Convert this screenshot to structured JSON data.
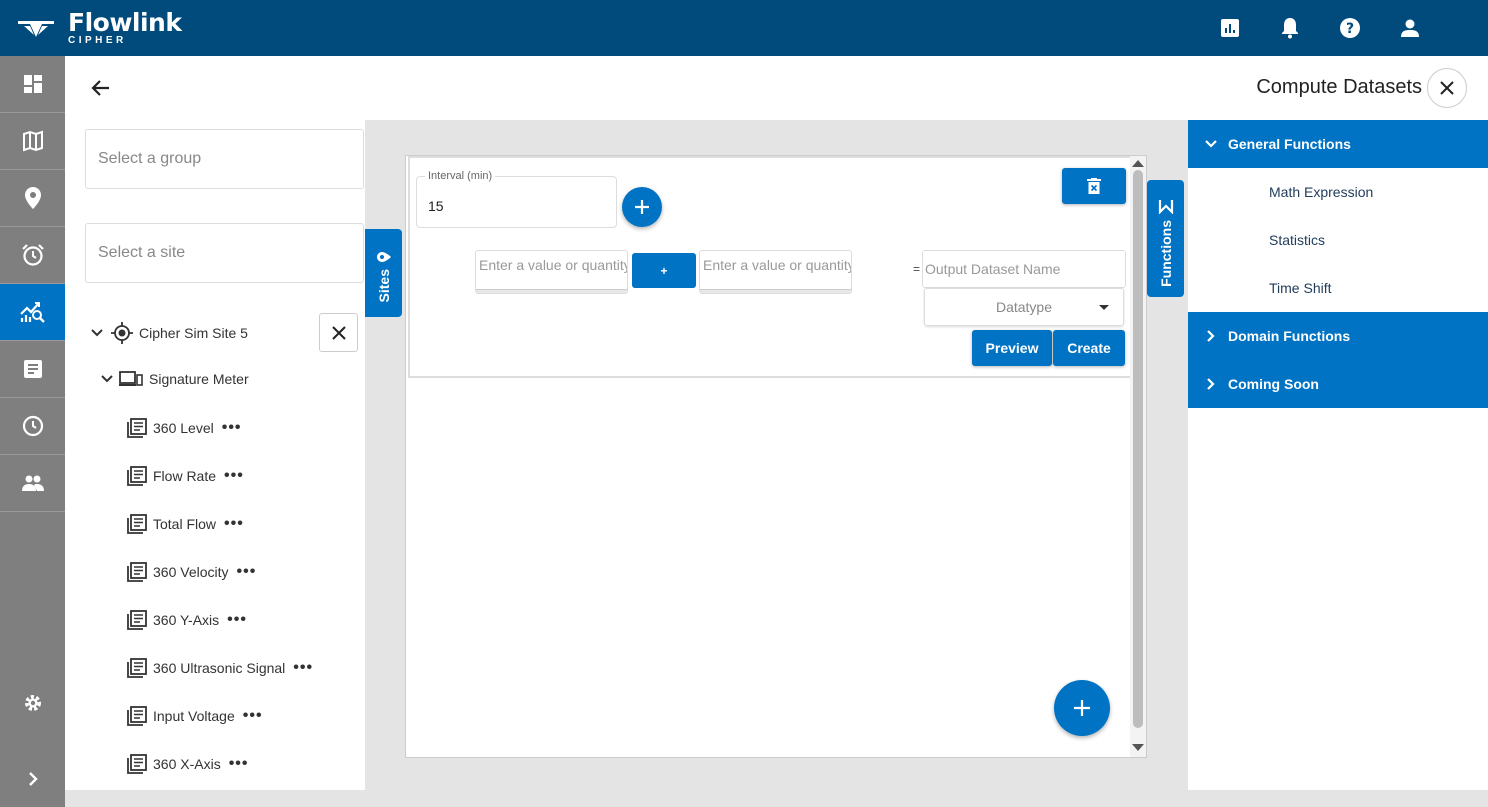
{
  "app": {
    "brand": "Flowlink",
    "brand_sub": "CIPHER"
  },
  "colors": {
    "topbar": "#004a7c",
    "accent": "#0073c4",
    "nav": "#7f7f7f"
  },
  "topbar_icons": [
    "report-icon",
    "bell-icon",
    "help-icon",
    "user-icon"
  ],
  "nav_icons": [
    "dashboard-icon",
    "map-icon",
    "location-pin-icon",
    "alarm-icon",
    "analytics-icon",
    "report-list-icon",
    "history-icon",
    "users-icon"
  ],
  "nav_active": "analytics-icon",
  "header": {
    "title": "Compute Datasets"
  },
  "sites_panel": {
    "group_placeholder": "Select a group",
    "site_placeholder": "Select a site",
    "site_name": "Cipher Sim Site 5",
    "device_name": "Signature Meter",
    "datasets": [
      "360 Level",
      "Flow Rate",
      "Total Flow",
      "360 Velocity",
      "360 Y-Axis",
      "360 Ultrasonic Signal",
      "Input Voltage",
      "360 X-Axis"
    ]
  },
  "tabs": {
    "sites": "Sites",
    "functions": "Functions"
  },
  "compute_card": {
    "interval_label": "Interval (min)",
    "interval_value": "15",
    "operand1_placeholder": "Enter a value or quantity",
    "operator": "+",
    "operand2_placeholder": "Enter a value or quantity",
    "equals": "=",
    "output_placeholder": "Output Dataset Name",
    "datatype_placeholder": "Datatype",
    "preview_label": "Preview",
    "create_label": "Create"
  },
  "functions_panel": {
    "general": "General Functions",
    "general_items": [
      "Math Expression",
      "Statistics",
      "Time Shift"
    ],
    "domain": "Domain Functions",
    "coming_soon": "Coming Soon"
  }
}
